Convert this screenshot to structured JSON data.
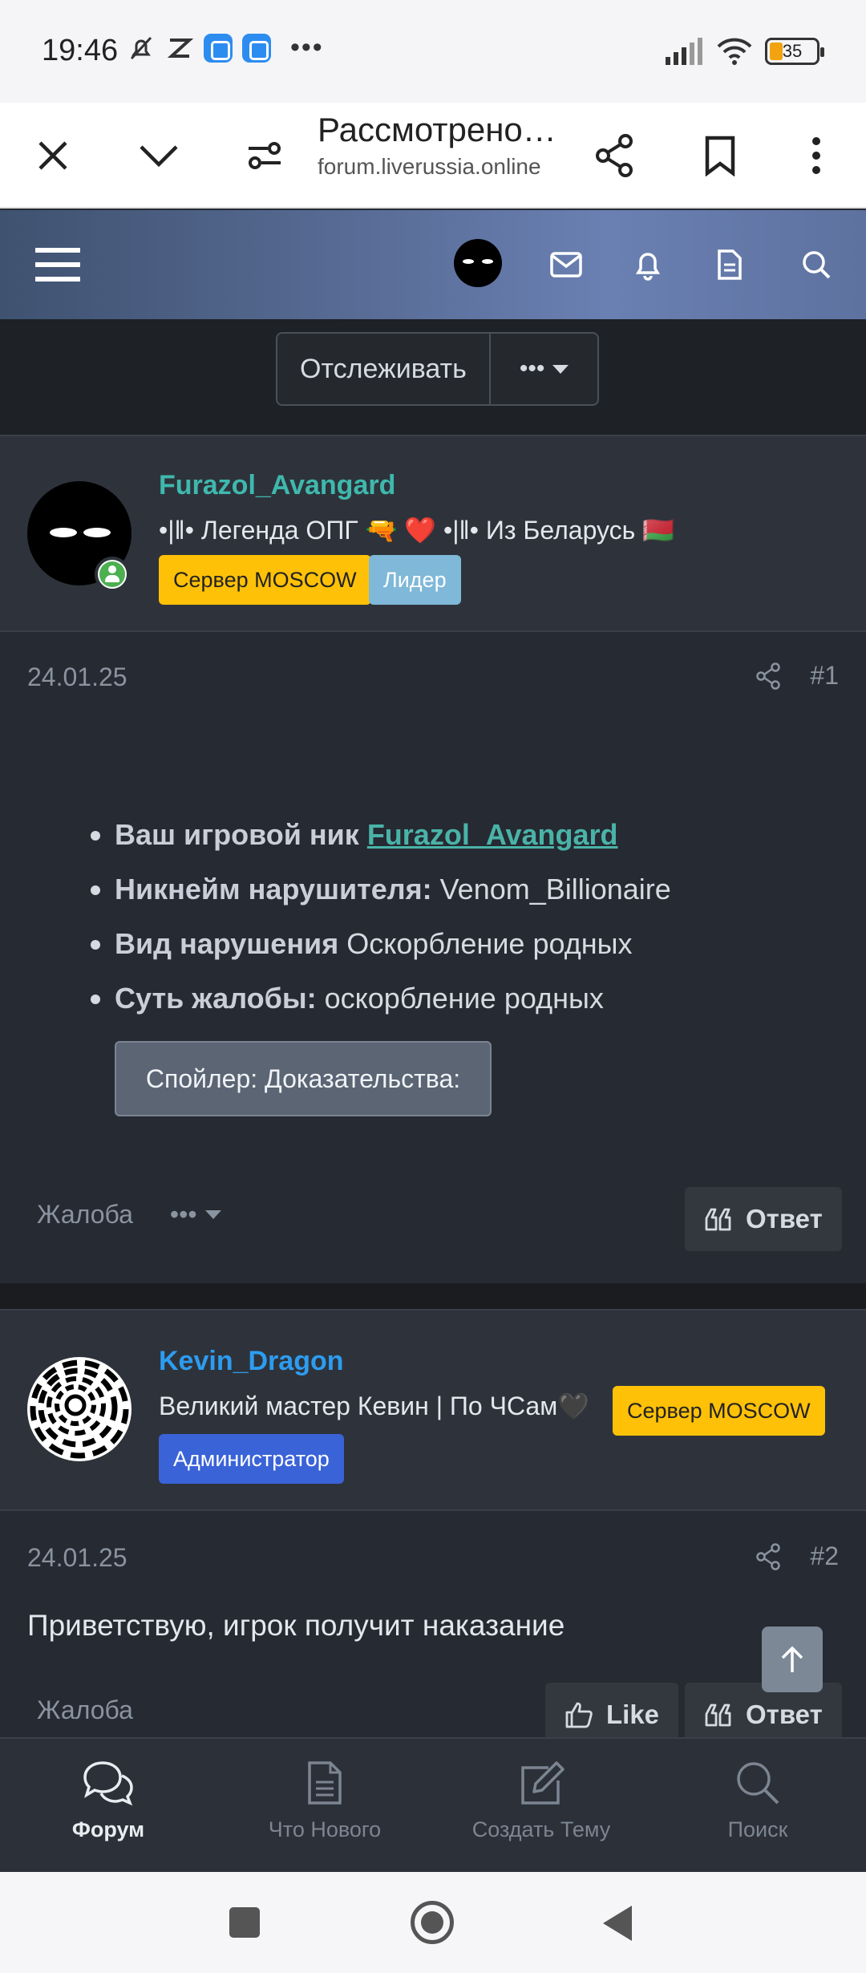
{
  "status_bar": {
    "time": "19:46",
    "battery": "35"
  },
  "browser": {
    "page_title": "Рассмотрено…",
    "url": "forum.liverussia.online"
  },
  "thread": {
    "watch_label": "Отслеживать",
    "more_label": "•••"
  },
  "posts": [
    {
      "author": "Furazol_Avangard",
      "author_color": "#3fb8ad",
      "user_title": "•|‖• Легенда ОПГ 🔫 ❤️ •|‖• Из Беларусь 🇧🇾",
      "badges": [
        "Сервер MOSCOW",
        "Лидер"
      ],
      "date": "24.01.25",
      "number": "#1",
      "fields": [
        {
          "label": "Ваш игровой ник ",
          "value": "Furazol_Avangard"
        },
        {
          "label": "Никнейм нарушителя:",
          "value": " Venom_Billionaire"
        },
        {
          "label": "Вид нарушения",
          "value": " Оскорбление родных"
        },
        {
          "label": "Суть жалобы:",
          "value": " оскорбление родных"
        }
      ],
      "spoiler_label": "Спойлер: Доказательства:",
      "report_label": "Жалоба",
      "more_label": "•••",
      "reply_label": "Ответ"
    },
    {
      "author": "Kevin_Dragon",
      "author_color": "#2d9cf0",
      "user_title": "Великий мастер Кевин | По ЧСам🖤",
      "badges": [
        "Сервер MOSCOW",
        "Администратор"
      ],
      "date": "24.01.25",
      "number": "#2",
      "text": "Приветствую, игрок получит наказание",
      "report_label": "Жалоба",
      "like_label": "Like",
      "reply_label": "Ответ"
    }
  ],
  "bottom_nav": [
    {
      "label": "Форум",
      "icon": "chat-bubbles-icon",
      "active": true
    },
    {
      "label": "Что Нового",
      "icon": "document-icon",
      "active": false
    },
    {
      "label": "Создать Тему",
      "icon": "edit-icon",
      "active": false
    },
    {
      "label": "Поиск",
      "icon": "search-icon",
      "active": false
    }
  ]
}
